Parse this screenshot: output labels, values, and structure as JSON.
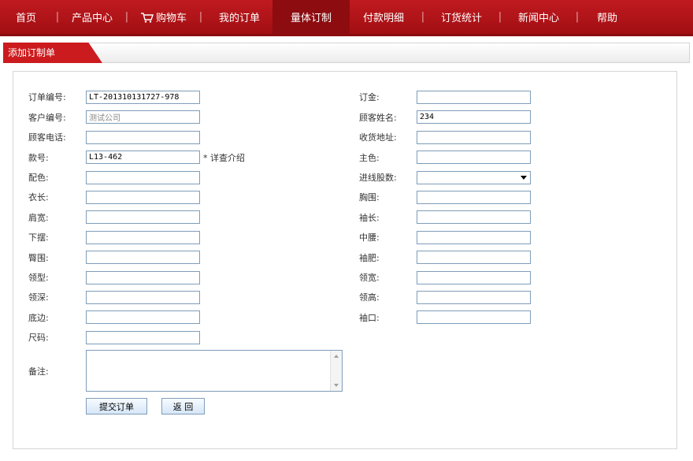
{
  "nav": {
    "items": [
      {
        "label": "首页"
      },
      {
        "label": "产品中心"
      },
      {
        "label": "购物车"
      },
      {
        "label": "我的订单"
      },
      {
        "label": "量体订制",
        "active": true
      },
      {
        "label": "付款明细"
      },
      {
        "label": "订货统计"
      },
      {
        "label": "新闻中心"
      },
      {
        "label": "帮助"
      }
    ],
    "separator": "|",
    "cart_icon": "cart-icon",
    "accent": "#b5151a"
  },
  "section": {
    "tab_title": "添加订制单"
  },
  "form": {
    "order_no": {
      "label": "订单编号:",
      "value": "LT-201310131727-978"
    },
    "customer_no": {
      "label": "客户编号:",
      "value": "测试公司"
    },
    "customer_phone": {
      "label": "顾客电话:",
      "value": ""
    },
    "style_no": {
      "label": "款号:",
      "value": "L13-462",
      "hint": "* 详查介绍"
    },
    "accent_color": {
      "label": "配色:",
      "value": ""
    },
    "length": {
      "label": "衣长:",
      "value": ""
    },
    "shoulder": {
      "label": "肩宽:",
      "value": ""
    },
    "hem": {
      "label": "下摆:",
      "value": ""
    },
    "hip": {
      "label": "臀围:",
      "value": ""
    },
    "collar_type": {
      "label": "领型:",
      "value": ""
    },
    "collar_depth": {
      "label": "领深:",
      "value": ""
    },
    "bottom_edge": {
      "label": "底边:",
      "value": ""
    },
    "size": {
      "label": "尺码:",
      "value": ""
    },
    "deposit": {
      "label": "订金:",
      "value": ""
    },
    "customer_name": {
      "label": "顾客姓名:",
      "value": "234"
    },
    "address": {
      "label": "收货地址:",
      "value": ""
    },
    "main_color": {
      "label": "主色:",
      "value": ""
    },
    "yarn_strands": {
      "label": "进线股数:",
      "value": ""
    },
    "chest": {
      "label": "胸围:",
      "value": ""
    },
    "sleeve_length": {
      "label": "袖长:",
      "value": ""
    },
    "waist": {
      "label": "中腰:",
      "value": ""
    },
    "sleeve_width": {
      "label": "袖肥:",
      "value": ""
    },
    "collar_width": {
      "label": "领宽:",
      "value": ""
    },
    "collar_height": {
      "label": "领高:",
      "value": ""
    },
    "cuff": {
      "label": "袖口:",
      "value": ""
    },
    "remark": {
      "label": "备注:",
      "value": ""
    }
  },
  "buttons": {
    "submit": "提交订单",
    "back": "返 回"
  }
}
